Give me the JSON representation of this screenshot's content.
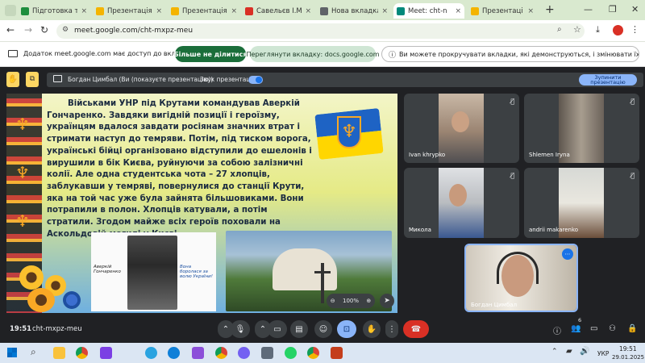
{
  "tabs": [
    {
      "label": "Підготовка та за",
      "color": "#1e8e3e"
    },
    {
      "label": "Презентація до",
      "color": "#f4b400"
    },
    {
      "label": "Презентація до",
      "color": "#f4b400"
    },
    {
      "label": "Савельєв І.М. п",
      "color": "#d93025"
    },
    {
      "label": "Нова вкладка",
      "color": "#5f6368"
    },
    {
      "label": "Meet: cht-n",
      "color": "#00897b"
    },
    {
      "label": "Презентаці",
      "color": "#f4b400"
    }
  ],
  "address": {
    "url": "meet.google.com/cht-mxpz-meu"
  },
  "infobar": {
    "message": "Додаток meet.google.com має доступ до вкладки...",
    "stop_share": "Більше не ділитися",
    "view_tab": "Переглянути вкладку: docs.google.com",
    "notice": "Ви можете прокручувати вкладки, які демонструються, і змінювати їх масштаб"
  },
  "presenter_bar": {
    "presenter": "Богдан Цимбал (Ви (показуєте презентацію))",
    "audio": "Звук презентації",
    "stop": "Зупинити презентацію"
  },
  "slide": {
    "text": "Військами УНР під Крутами командував Аверкій Гончаренко. Завдяки вигідній позиції і героїзму, українцям вдалося завдати росіянам значних втрат і стримати наступ до темряви. Потім, під тиском ворога, українські бійці організовано відступили до ешелонів і вирушили в бік Києва, руйнуючи за собою залізничні колії. Але одна студентська чота – 27 хлопців, заблукавши у темряві, повернулися до станції Крути, яка на той час уже була зайнята більшовиками. Вони потрапили в полон. Хлопців катували, а потім стратили. Згодом майже всіх героїв поховали на Аскольдовій могилі у Києві.",
    "photo_caption_left": "Аверкій Гончаренко",
    "photo_caption_right": "Вона боролася за волю України!",
    "zoom": "100%"
  },
  "participants": [
    {
      "name": "Ivan khrypko"
    },
    {
      "name": "Shlemen Iryna"
    },
    {
      "name": "Миколa"
    },
    {
      "name": "andrii makarenko"
    },
    {
      "name": "Богдан Цимбал"
    }
  ],
  "meeting": {
    "time": "19:51",
    "code": "cht-mxpz-meu",
    "people_count": "6"
  },
  "taskbar": {
    "lang": "УКР",
    "time": "19:51",
    "date": "29.01.2025"
  }
}
